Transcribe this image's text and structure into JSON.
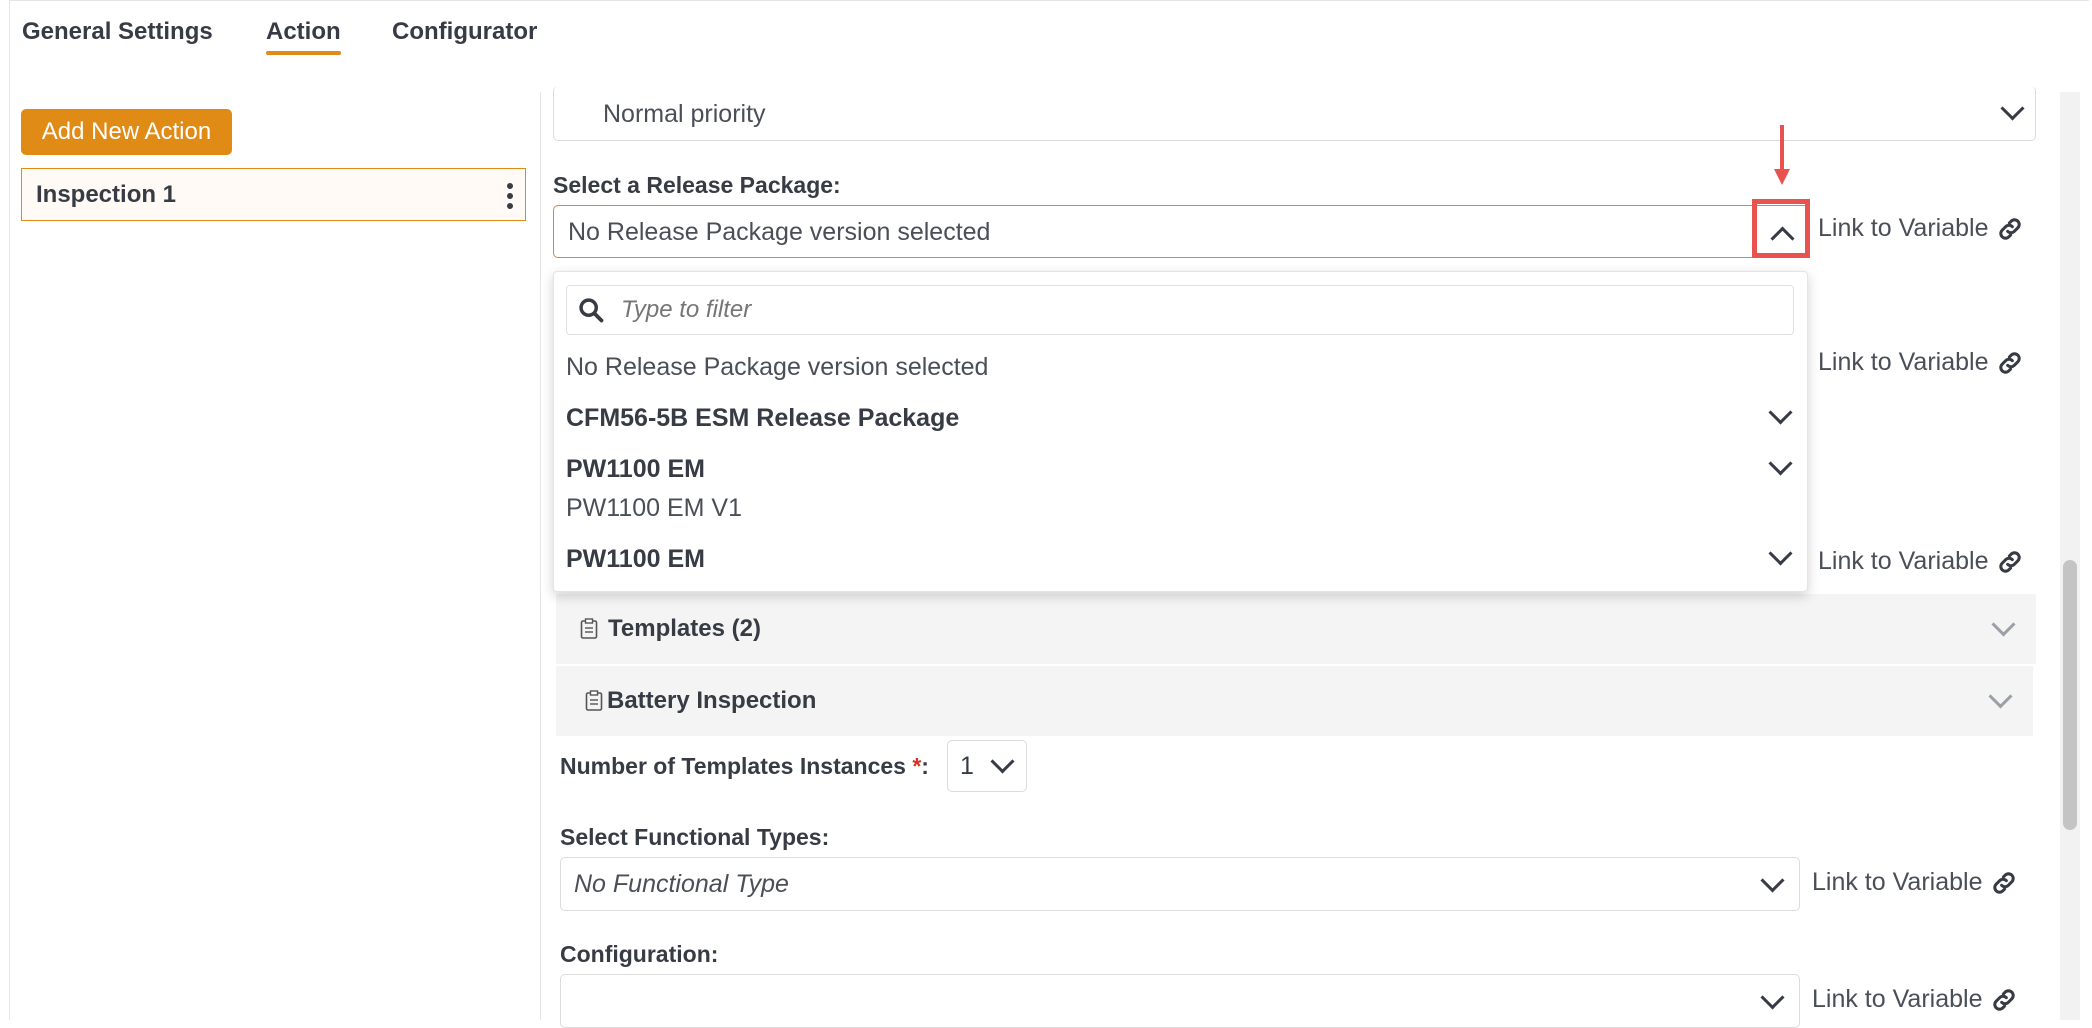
{
  "tabs": [
    {
      "label": "General Settings"
    },
    {
      "label": "Action"
    },
    {
      "label": "Configurator"
    }
  ],
  "active_tab": "Action",
  "left_panel": {
    "add_button": "Add New Action",
    "actions": [
      {
        "label": "Inspection 1"
      }
    ]
  },
  "priority": {
    "value": "Normal priority"
  },
  "release_package": {
    "label": "Select a Release Package:",
    "value": "No Release Package version selected",
    "link_label": "Link to Variable",
    "dropdown": {
      "filter_placeholder": "Type to filter",
      "options": [
        {
          "label": "No Release Package version selected",
          "type": "option"
        },
        {
          "label": "CFM56-5B ESM Release Package",
          "type": "group"
        },
        {
          "label": "PW1100 EM",
          "type": "group"
        },
        {
          "label": "PW1100 EM V1",
          "type": "option"
        },
        {
          "label": "PW1100 EM",
          "type": "group"
        }
      ]
    }
  },
  "hidden_links": [
    "Link to Variable",
    "Link to Variable"
  ],
  "accordions": [
    {
      "title": "Templates (2)",
      "icon": "clipboard-icon"
    },
    {
      "title": "Battery Inspection",
      "icon": "clipboard-icon"
    }
  ],
  "template_instances": {
    "label": "Number of Templates Instances",
    "required_mark": "*",
    "colon": ":",
    "value": "1"
  },
  "functional_types": {
    "label": "Select Functional Types:",
    "value": "No Functional Type",
    "link_label": "Link to Variable"
  },
  "configuration": {
    "label": "Configuration:",
    "value": "",
    "link_label": "Link to Variable"
  },
  "colors": {
    "accent": "#e08b16",
    "highlight": "#e9534f",
    "text": "#363b44"
  }
}
